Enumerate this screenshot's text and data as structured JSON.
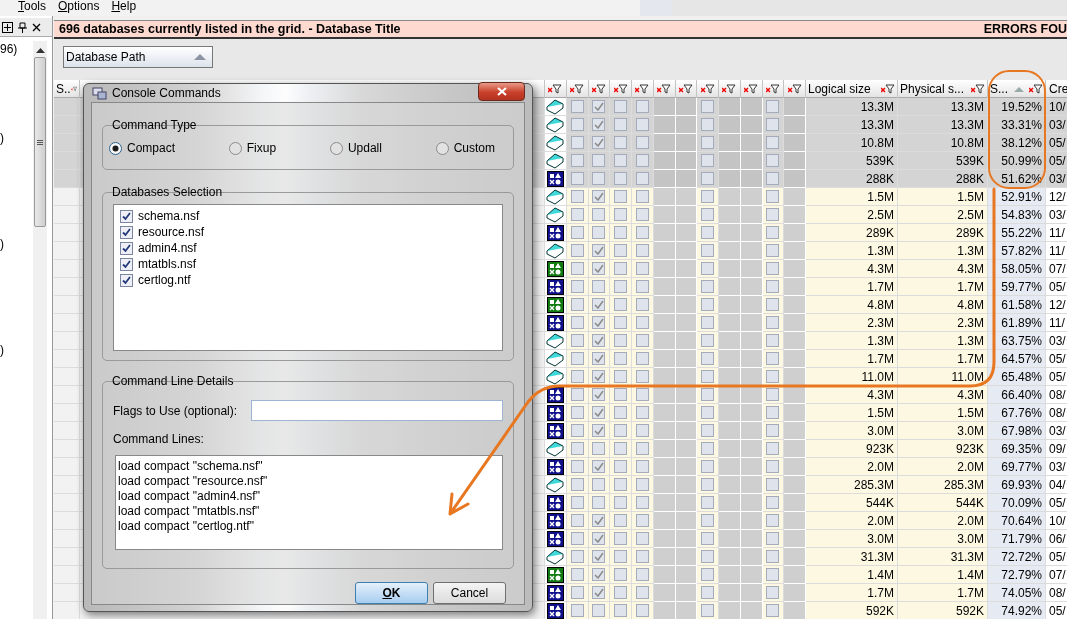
{
  "menu": [
    {
      "label": "Tools"
    },
    {
      "label": "Options"
    },
    {
      "label": "Help"
    }
  ],
  "left_pane": {
    "tree_texts": [
      "96)",
      ")",
      ")",
      ")"
    ]
  },
  "title_bar": {
    "text": "696 databases currently listed in the grid. - Database Title",
    "status": "ERRORS FOU"
  },
  "group_panel": {
    "label": "Database Path"
  },
  "grid": {
    "columns": [
      {
        "label": "S..",
        "filter": true
      },
      {
        "kind": "hidden"
      },
      {
        "kind": "icon",
        "filter": true
      },
      {
        "kind": "checkbox",
        "filter": true
      },
      {
        "kind": "checkbox",
        "filter": true
      },
      {
        "kind": "checkbox",
        "filter": true
      },
      {
        "kind": "checkbox",
        "filter": true
      },
      {
        "kind": "blank",
        "filter": true
      },
      {
        "kind": "blank",
        "filter": true
      },
      {
        "kind": "checkbox",
        "filter": true
      },
      {
        "kind": "blank",
        "filter": true
      },
      {
        "kind": "blank",
        "filter": true
      },
      {
        "kind": "checkbox",
        "filter": true
      },
      {
        "kind": "blank",
        "filter": true
      },
      {
        "kind": "size",
        "label": "Logical size",
        "filter": true
      },
      {
        "kind": "size",
        "label": "Physical s...",
        "filter": true
      },
      {
        "kind": "ratio",
        "label": "S...",
        "filter": true,
        "sorted": true
      },
      {
        "kind": "date",
        "label": "Cre"
      }
    ],
    "rows": [
      {
        "selected": true,
        "kind": "book",
        "color": "#40d8d8",
        "checks": [
          false,
          true,
          false,
          false,
          false,
          false
        ],
        "logical": "13.3M",
        "physical": "13.3M",
        "ratio": "19.52%",
        "cre": "10/"
      },
      {
        "selected": true,
        "kind": "book",
        "color": "#40d8d8",
        "checks": [
          false,
          true,
          false,
          false,
          false,
          false
        ],
        "logical": "13.3M",
        "physical": "13.3M",
        "ratio": "33.31%",
        "cre": "03/"
      },
      {
        "selected": true,
        "kind": "book",
        "color": "#40d8d8",
        "checks": [
          false,
          true,
          false,
          false,
          false,
          false
        ],
        "logical": "10.8M",
        "physical": "10.8M",
        "ratio": "38.12%",
        "cre": "05/"
      },
      {
        "selected": true,
        "kind": "book",
        "color": "#40d8d8",
        "checks": [
          false,
          false,
          false,
          false,
          false,
          false
        ],
        "logical": "539K",
        "physical": "539K",
        "ratio": "50.99%",
        "cre": "05/"
      },
      {
        "selected": true,
        "kind": "shapes",
        "color": "#10108c",
        "checks": [
          false,
          false,
          false,
          false,
          false,
          false
        ],
        "logical": "288K",
        "physical": "288K",
        "ratio": "51.62%",
        "cre": "03/"
      },
      {
        "selected": false,
        "kind": "book",
        "color": "#40d8d8",
        "checks": [
          false,
          true,
          false,
          false,
          false,
          false
        ],
        "logical": "1.5M",
        "physical": "1.5M",
        "ratio": "52.91%",
        "cre": "12/"
      },
      {
        "selected": false,
        "kind": "book",
        "color": "#40d8d8",
        "checks": [
          false,
          false,
          false,
          false,
          false,
          false
        ],
        "logical": "2.5M",
        "physical": "2.5M",
        "ratio": "54.83%",
        "cre": "03/"
      },
      {
        "selected": false,
        "kind": "shapes",
        "color": "#10108c",
        "checks": [
          false,
          false,
          false,
          false,
          false,
          false
        ],
        "logical": "289K",
        "physical": "289K",
        "ratio": "55.22%",
        "cre": "11/"
      },
      {
        "selected": false,
        "kind": "book",
        "color": "#40d8d8",
        "checks": [
          false,
          true,
          false,
          false,
          false,
          false
        ],
        "logical": "1.3M",
        "physical": "1.3M",
        "ratio": "57.82%",
        "cre": "11/"
      },
      {
        "selected": false,
        "kind": "shapes",
        "color": "#107c10",
        "checks": [
          false,
          true,
          false,
          false,
          false,
          false
        ],
        "logical": "4.3M",
        "physical": "4.3M",
        "ratio": "58.05%",
        "cre": "07/"
      },
      {
        "selected": false,
        "kind": "shapes",
        "color": "#10108c",
        "checks": [
          false,
          false,
          false,
          false,
          false,
          false
        ],
        "logical": "1.7M",
        "physical": "1.7M",
        "ratio": "59.77%",
        "cre": "05/"
      },
      {
        "selected": false,
        "kind": "shapes",
        "color": "#107c10",
        "checks": [
          false,
          true,
          false,
          false,
          false,
          false
        ],
        "logical": "4.8M",
        "physical": "4.8M",
        "ratio": "61.58%",
        "cre": "12/"
      },
      {
        "selected": false,
        "kind": "shapes",
        "color": "#10108c",
        "checks": [
          false,
          true,
          false,
          false,
          false,
          false
        ],
        "logical": "2.3M",
        "physical": "2.3M",
        "ratio": "61.89%",
        "cre": "11/"
      },
      {
        "selected": false,
        "kind": "book",
        "color": "#40d8d8",
        "checks": [
          false,
          true,
          false,
          false,
          false,
          false
        ],
        "logical": "1.3M",
        "physical": "1.3M",
        "ratio": "63.75%",
        "cre": "03/"
      },
      {
        "selected": false,
        "kind": "book",
        "color": "#40d8d8",
        "checks": [
          false,
          true,
          false,
          false,
          false,
          false
        ],
        "logical": "1.7M",
        "physical": "1.7M",
        "ratio": "64.57%",
        "cre": "05/"
      },
      {
        "selected": false,
        "kind": "book",
        "color": "#40d8d8",
        "checks": [
          false,
          true,
          false,
          false,
          false,
          false
        ],
        "logical": "11.0M",
        "physical": "11.0M",
        "ratio": "65.48%",
        "cre": "05/"
      },
      {
        "selected": false,
        "kind": "shapes",
        "color": "#10108c",
        "checks": [
          false,
          true,
          false,
          false,
          false,
          false
        ],
        "logical": "4.3M",
        "physical": "4.3M",
        "ratio": "66.40%",
        "cre": "08/"
      },
      {
        "selected": false,
        "kind": "shapes",
        "color": "#10108c",
        "checks": [
          false,
          true,
          false,
          false,
          false,
          false
        ],
        "logical": "1.5M",
        "physical": "1.5M",
        "ratio": "67.76%",
        "cre": "08/"
      },
      {
        "selected": false,
        "kind": "shapes",
        "color": "#10108c",
        "checks": [
          false,
          true,
          false,
          false,
          false,
          false
        ],
        "logical": "3.0M",
        "physical": "3.0M",
        "ratio": "67.98%",
        "cre": "03/"
      },
      {
        "selected": false,
        "kind": "book",
        "color": "#40d8d8",
        "checks": [
          false,
          false,
          false,
          false,
          false,
          false
        ],
        "logical": "923K",
        "physical": "923K",
        "ratio": "69.35%",
        "cre": "09/"
      },
      {
        "selected": false,
        "kind": "shapes",
        "color": "#10108c",
        "checks": [
          false,
          true,
          false,
          false,
          false,
          false
        ],
        "logical": "2.0M",
        "physical": "2.0M",
        "ratio": "69.77%",
        "cre": "03/"
      },
      {
        "selected": false,
        "kind": "book",
        "color": "#40d8d8",
        "checks": [
          false,
          false,
          false,
          false,
          false,
          false
        ],
        "logical": "285.3M",
        "physical": "285.3M",
        "ratio": "69.93%",
        "cre": "04/"
      },
      {
        "selected": false,
        "kind": "shapes",
        "color": "#10108c",
        "checks": [
          false,
          false,
          false,
          false,
          false,
          false
        ],
        "logical": "544K",
        "physical": "544K",
        "ratio": "70.09%",
        "cre": "05/"
      },
      {
        "selected": false,
        "kind": "shapes",
        "color": "#10108c",
        "checks": [
          false,
          true,
          false,
          false,
          false,
          false
        ],
        "logical": "2.0M",
        "physical": "2.0M",
        "ratio": "70.64%",
        "cre": "10/"
      },
      {
        "selected": false,
        "kind": "shapes",
        "color": "#10108c",
        "checks": [
          false,
          true,
          false,
          false,
          false,
          false
        ],
        "logical": "3.0M",
        "physical": "3.0M",
        "ratio": "71.79%",
        "cre": "06/"
      },
      {
        "selected": false,
        "kind": "book",
        "color": "#40d8d8",
        "checks": [
          false,
          true,
          false,
          false,
          false,
          false
        ],
        "logical": "31.3M",
        "physical": "31.3M",
        "ratio": "72.72%",
        "cre": "05/"
      },
      {
        "selected": false,
        "kind": "shapes",
        "color": "#107c10",
        "checks": [
          false,
          true,
          false,
          false,
          false,
          false
        ],
        "logical": "1.4M",
        "physical": "1.4M",
        "ratio": "72.79%",
        "cre": "07/"
      },
      {
        "selected": false,
        "kind": "shapes",
        "color": "#10108c",
        "checks": [
          false,
          true,
          false,
          false,
          false,
          false
        ],
        "logical": "1.7M",
        "physical": "1.7M",
        "ratio": "74.05%",
        "cre": "08/"
      },
      {
        "selected": false,
        "kind": "shapes",
        "color": "#10108c",
        "checks": [
          false,
          false,
          false,
          false,
          false,
          false
        ],
        "logical": "592K",
        "physical": "592K",
        "ratio": "74.92%",
        "cre": "05/"
      }
    ]
  },
  "dialog": {
    "title": "Console Commands",
    "command_type": {
      "legend": "Command Type",
      "options": [
        {
          "label": "Compact",
          "selected": true
        },
        {
          "label": "Fixup",
          "selected": false
        },
        {
          "label": "Updall",
          "selected": false
        },
        {
          "label": "Custom",
          "selected": false
        }
      ]
    },
    "databases": {
      "legend": "Databases Selection",
      "items": [
        {
          "label": "schema.nsf",
          "checked": true
        },
        {
          "label": "resource.nsf",
          "checked": true
        },
        {
          "label": "admin4.nsf",
          "checked": true
        },
        {
          "label": "mtatbls.nsf",
          "checked": true
        },
        {
          "label": "certlog.ntf",
          "checked": true
        }
      ]
    },
    "details": {
      "legend": "Command Line Details",
      "flags_label": "Flags to Use (optional):",
      "lines_label": "Command Lines:",
      "lines": [
        "load compact \"schema.nsf\"",
        "load compact \"resource.nsf\"",
        "load compact \"admin4.nsf\"",
        "load compact \"mtatbls.nsf\"",
        "load compact \"certlog.ntf\""
      ]
    },
    "buttons": [
      {
        "label": "OK",
        "default": true
      },
      {
        "label": "Cancel",
        "default": false
      }
    ]
  }
}
